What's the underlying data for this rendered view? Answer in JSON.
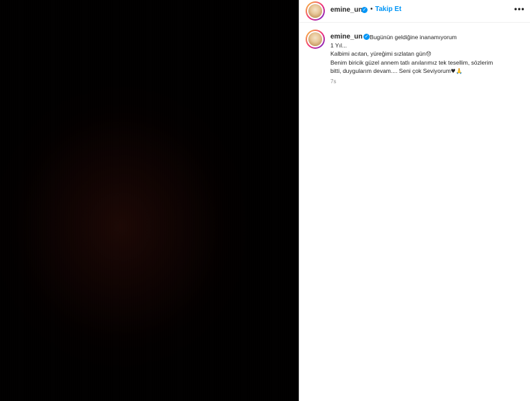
{
  "post": {
    "media_alt": "",
    "header": {
      "username": "emine_un",
      "separator": "•",
      "follow_label": "Takip Et",
      "more_label": "•••"
    },
    "caption": {
      "username": "emine_un",
      "line1": "Bugünün geldiğine inanamıyorum",
      "line2": "1 Yıl...",
      "line3": "Kalbimi acıtan, yüreğimi sızlatan gün",
      "line3_emoji": "😞",
      "line4": "Benim biricik güzel annem tatlı anılarımız tek tesellim, sözlerim",
      "line5": "bitti, duygularım devam.... Seni çok Seviyorum",
      "line5_emoji": "♥🙏",
      "time": "7s"
    }
  },
  "colors": {
    "link_blue": "#0095f6",
    "text": "#262626",
    "muted": "#8e8e8e"
  }
}
